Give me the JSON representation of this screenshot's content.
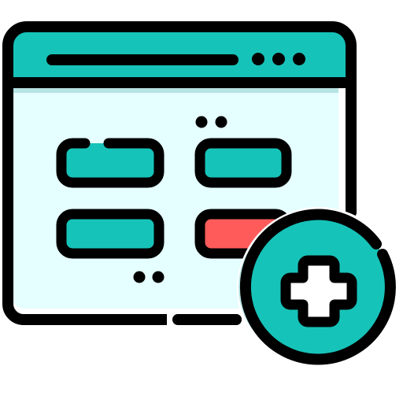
{
  "icon": {
    "name": "web-page-add-icon",
    "colors": {
      "outline": "#000000",
      "accent_teal": "#16C3B9",
      "page_background": "#E5FEFF",
      "page_shadow": "#B7E3E3",
      "alert_red": "#FF5B5B",
      "plus_fill": "#FFFFFF"
    },
    "window": {
      "control_dots": 3
    },
    "content_blocks": [
      {
        "color": "teal"
      },
      {
        "color": "teal"
      },
      {
        "color": "teal"
      },
      {
        "color": "red"
      }
    ],
    "badge": {
      "symbol": "plus"
    }
  }
}
